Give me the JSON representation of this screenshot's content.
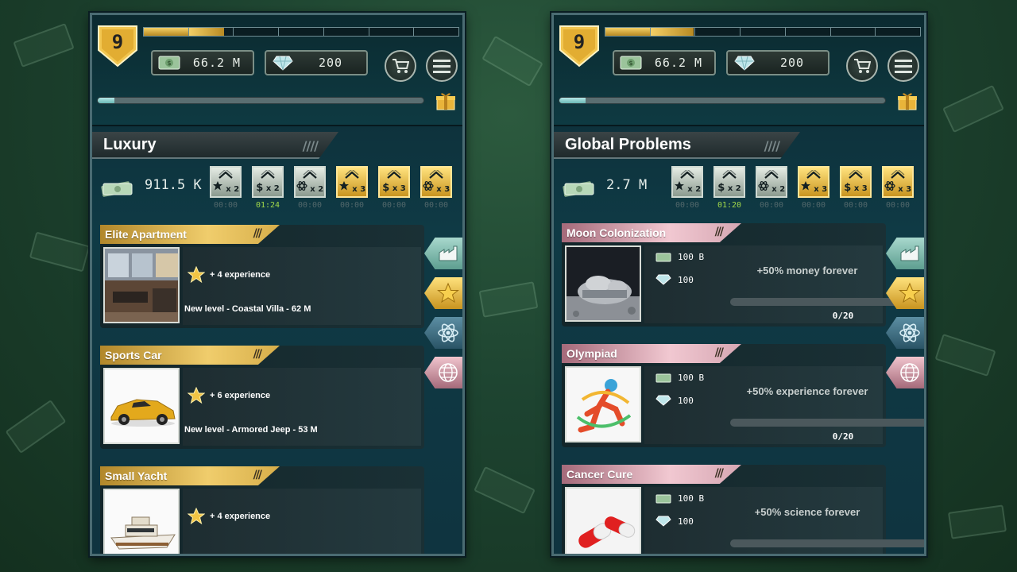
{
  "panels": [
    {
      "level": "9",
      "money": "66.2 M",
      "gems": "200",
      "xp_progress": 0.19,
      "bar_progress": 0.05,
      "section_title": "Luxury",
      "income": "911.5 K",
      "boosts": [
        {
          "label": "x 2",
          "icon": "star-icon",
          "style": "silver",
          "timer": "00:00"
        },
        {
          "label": "x 2",
          "icon": "dollar-icon",
          "style": "silver",
          "timer": "01:24"
        },
        {
          "label": "x 2",
          "icon": "atom-icon",
          "style": "silver",
          "timer": "00:00"
        },
        {
          "label": "x 3",
          "icon": "star-icon",
          "style": "gold",
          "timer": "00:00"
        },
        {
          "label": "x 3",
          "icon": "dollar-icon",
          "style": "gold",
          "timer": "00:00"
        },
        {
          "label": "x 3",
          "icon": "atom-icon",
          "style": "gold",
          "timer": "00:00"
        }
      ],
      "items": [
        {
          "name": "Elite Apartment",
          "xp": "+ 4 experience",
          "next": "New level - Coastal Villa - 62 M",
          "pic": "apartment"
        },
        {
          "name": "Sports Car",
          "xp": "+ 6 experience",
          "next": "New level - Armored Jeep - 53 M",
          "pic": "car"
        },
        {
          "name": "Small Yacht",
          "xp": "+ 4 experience",
          "next": "",
          "pic": "yacht"
        }
      ]
    },
    {
      "level": "9",
      "money": "66.2 M",
      "gems": "200",
      "xp_progress": 0.21,
      "bar_progress": 0.08,
      "section_title": "Global Problems",
      "income": "2.7 M",
      "boosts": [
        {
          "label": "x 2",
          "icon": "star-icon",
          "style": "silver",
          "timer": "00:00"
        },
        {
          "label": "x 2",
          "icon": "dollar-icon",
          "style": "silver",
          "timer": "01:20"
        },
        {
          "label": "x 2",
          "icon": "atom-icon",
          "style": "silver",
          "timer": "00:00"
        },
        {
          "label": "x 3",
          "icon": "star-icon",
          "style": "gold",
          "timer": "00:00"
        },
        {
          "label": "x 3",
          "icon": "dollar-icon",
          "style": "gold",
          "timer": "00:00"
        },
        {
          "label": "x 3",
          "icon": "atom-icon",
          "style": "gold",
          "timer": "00:00"
        }
      ],
      "problems": [
        {
          "name": "Moon Colonization",
          "money_cost": "100 B",
          "gem_cost": "100",
          "bonus": "+50% money forever",
          "progress_text": "0/20",
          "pic": "moon"
        },
        {
          "name": "Olympiad",
          "money_cost": "100 B",
          "gem_cost": "100",
          "bonus": "+50% experience forever",
          "progress_text": "0/20",
          "pic": "runner"
        },
        {
          "name": "Cancer Cure",
          "money_cost": "100 B",
          "gem_cost": "100",
          "bonus": "+50% science forever",
          "progress_text": "",
          "pic": "pills"
        }
      ]
    }
  ],
  "side_tabs": [
    "factory-icon",
    "star-icon",
    "atom-icon",
    "globe-icon"
  ],
  "colors": {
    "gold": "#f0cd6c",
    "pink": "#f1c8d1",
    "timer_active": "#a2d84a"
  }
}
